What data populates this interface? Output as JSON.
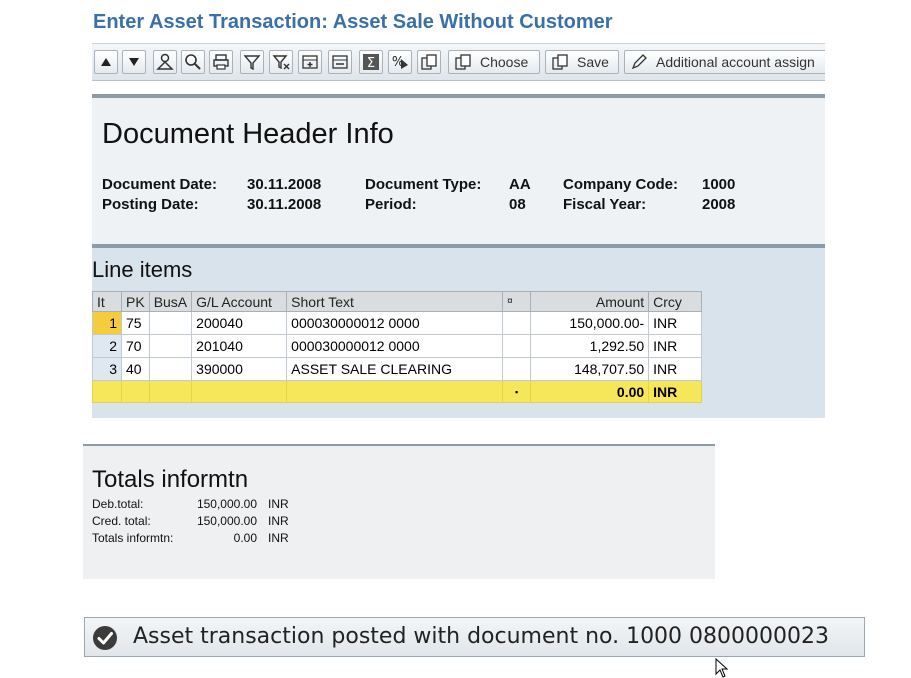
{
  "window": {
    "title": "Enter Asset Transaction: Asset Sale Without Customer"
  },
  "toolbar": {
    "icons": [
      "arrow-up",
      "arrow-down",
      "details",
      "find",
      "print",
      "filter",
      "set-filter",
      "insert-row",
      "delete-row",
      "sum",
      "subtotal",
      "export"
    ],
    "choose_label": "Choose",
    "save_label": "Save",
    "additional_label": "Additional account assign"
  },
  "document_header": {
    "title": "Document Header Info",
    "document_date_label": "Document Date:",
    "document_date": "30.11.2008",
    "posting_date_label": "Posting Date:",
    "posting_date": "30.11.2008",
    "document_type_label": "Document Type:",
    "document_type": "AA",
    "period_label": "Period:",
    "period": "08",
    "company_code_label": "Company Code:",
    "company_code": "1000",
    "fiscal_year_label": "Fiscal Year:",
    "fiscal_year": "2008"
  },
  "line_items": {
    "title": "Line items",
    "columns": [
      "It",
      "PK",
      "BusA",
      "G/L Account",
      "Short Text",
      "¤",
      "Amount",
      "Crcy"
    ],
    "rows": [
      {
        "it": "1",
        "pk": "75",
        "busa": "",
        "gl": "200040",
        "text": "000030000012 0000",
        "amount": "150,000.00-",
        "crcy": "INR"
      },
      {
        "it": "2",
        "pk": "70",
        "busa": "",
        "gl": "201040",
        "text": "000030000012 0000",
        "amount": "1,292.50",
        "crcy": "INR"
      },
      {
        "it": "3",
        "pk": "40",
        "busa": "",
        "gl": "390000",
        "text": "ASSET SALE CLEARING",
        "amount": "148,707.50",
        "crcy": "INR"
      }
    ],
    "total": {
      "marker": "▪",
      "amount": "0.00",
      "crcy": "INR"
    }
  },
  "totals": {
    "title": "Totals informtn",
    "deb_label": "Deb.total:",
    "deb_value": "150,000.00",
    "deb_crcy": "INR",
    "cred_label": "Cred. total:",
    "cred_value": "150,000.00",
    "cred_crcy": "INR",
    "info_label": "Totals informtn:",
    "info_value": "0.00",
    "info_crcy": "INR"
  },
  "status_bar": {
    "message": "Asset transaction posted with document no. 1000 0800000023",
    "icon": "checkmark-circle-icon"
  },
  "colors": {
    "title_blue": "#3a70aa",
    "total_row_yellow": "#f6e65a",
    "selected_item_orange": "#f5cc3c"
  }
}
